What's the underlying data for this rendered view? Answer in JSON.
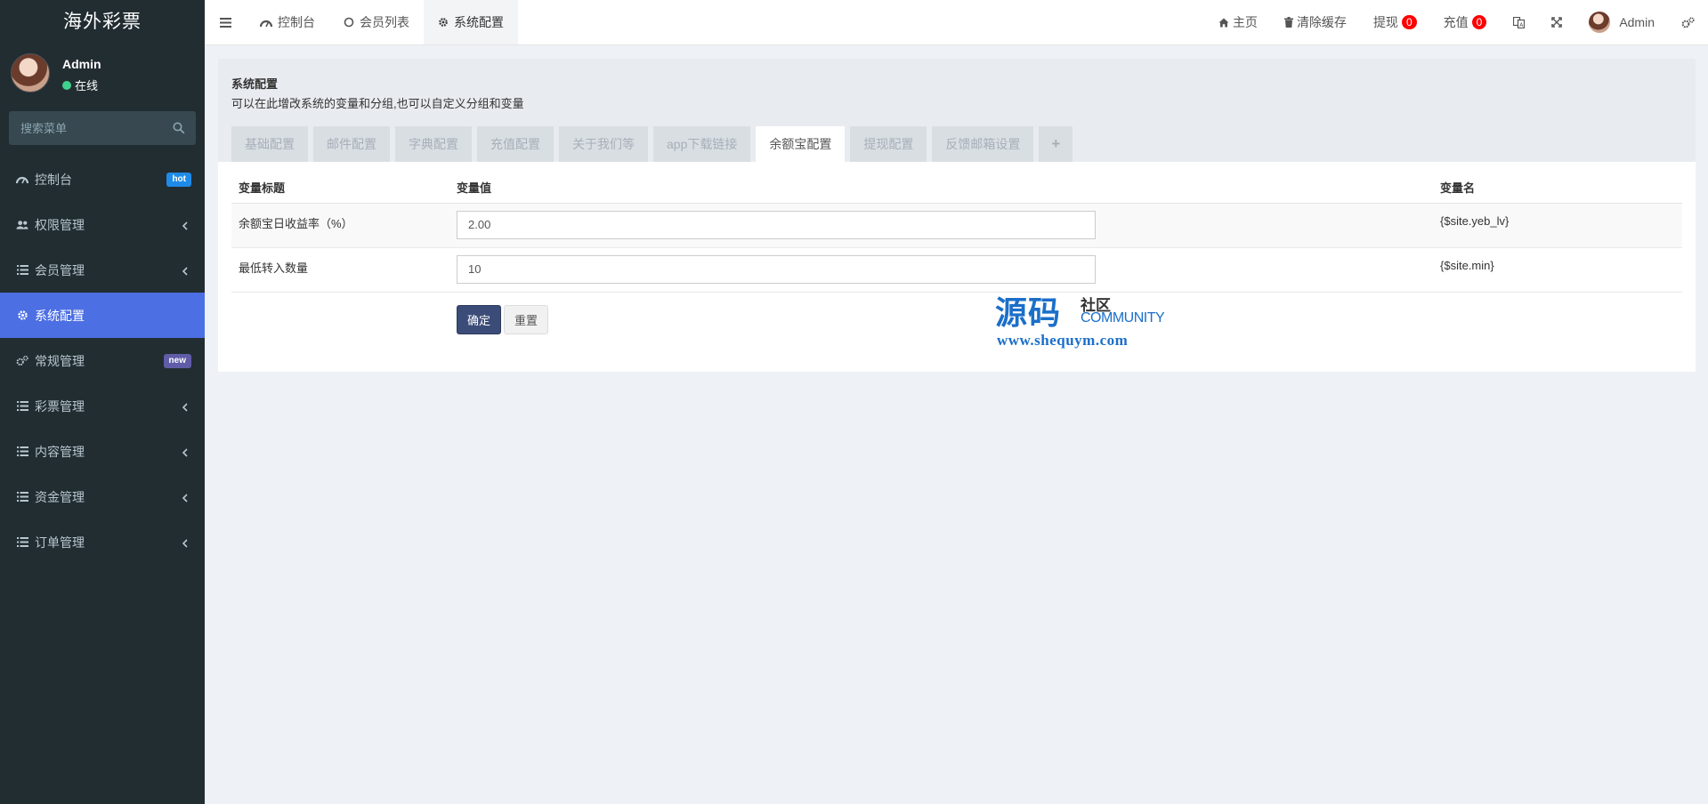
{
  "brand": {
    "title": "海外彩票"
  },
  "user": {
    "name": "Admin",
    "status": "在线"
  },
  "search": {
    "placeholder": "搜索菜单"
  },
  "sidebar": {
    "items": [
      {
        "label": "控制台",
        "icon": "dashboard-icon",
        "badge": "hot"
      },
      {
        "label": "权限管理",
        "icon": "users-icon"
      },
      {
        "label": "会员管理",
        "icon": "list-icon"
      },
      {
        "label": "系统配置",
        "icon": "gear-icon",
        "active": true
      },
      {
        "label": "常规管理",
        "icon": "cogs-icon",
        "badge": "new"
      },
      {
        "label": "彩票管理",
        "icon": "list-icon"
      },
      {
        "label": "内容管理",
        "icon": "list-icon"
      },
      {
        "label": "资金管理",
        "icon": "list-icon"
      },
      {
        "label": "订单管理",
        "icon": "list-icon"
      }
    ]
  },
  "topbar": {
    "tabs": [
      {
        "label": "控制台",
        "icon": "dashboard-icon"
      },
      {
        "label": "会员列表",
        "icon": "circle-icon"
      },
      {
        "label": "系统配置",
        "icon": "gear-icon",
        "active": true
      }
    ],
    "home": "主页",
    "clear_cache": "清除缓存",
    "withdraw": {
      "label": "提现",
      "count": "0"
    },
    "recharge": {
      "label": "充值",
      "count": "0"
    },
    "admin": "Admin"
  },
  "panel": {
    "title": "系统配置",
    "description": "可以在此增改系统的变量和分组,也可以自定义分组和变量",
    "tabs": [
      "基础配置",
      "邮件配置",
      "字典配置",
      "充值配置",
      "关于我们等",
      "app下载链接",
      "余额宝配置",
      "提现配置",
      "反馈邮箱设置"
    ],
    "active_tab": "余额宝配置",
    "plus": "+"
  },
  "table": {
    "headers": {
      "title": "变量标题",
      "value": "变量值",
      "name": "变量名"
    },
    "rows": [
      {
        "title": "余额宝日收益率（%）",
        "value": "2.00",
        "name": "{$site.yeb_lv}"
      },
      {
        "title": "最低转入数量",
        "value": "10",
        "name": "{$site.min}"
      }
    ]
  },
  "buttons": {
    "confirm": "确定",
    "reset": "重置"
  },
  "watermark": {
    "big": "源码",
    "small": "社区",
    "community": "COMMUNITY",
    "url": "www.shequym.com"
  },
  "colors": {
    "sidebar": "#222d32",
    "active": "#4c6fe3",
    "primary_btn": "#3b4c78",
    "badge_red": "#ff0000"
  }
}
